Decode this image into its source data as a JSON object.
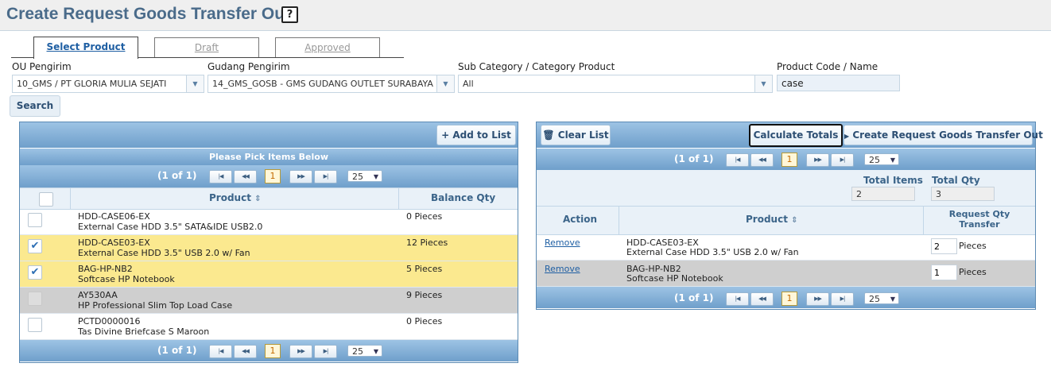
{
  "page": {
    "title": "Create Request Goods Transfer Out",
    "help_icon": "?"
  },
  "tabs": [
    "Select Product",
    "Draft",
    "Approved"
  ],
  "filters": {
    "ou_label": "OU Pengirim",
    "ou_value": "10_GMS / PT GLORIA MULIA SEJATI",
    "gudang_label": "Gudang Pengirim",
    "gudang_value": "14_GMS_GOSB - GMS GUDANG OUTLET SURABAYA",
    "category_label": "Sub Category / Category Product",
    "category_value": "All",
    "code_label": "Product Code / Name",
    "code_value": "case",
    "search_label": "Search"
  },
  "left_panel": {
    "add_label": "Add to List",
    "caption": "Please Pick Items Below",
    "pager": {
      "info": "(1 of 1)",
      "page": "1",
      "per_page": "25"
    },
    "columns": {
      "product": "Product",
      "balance": "Balance Qty"
    },
    "rows": [
      {
        "code": "HDD-CASE06-EX",
        "name": "External Case HDD 3.5\" SATA&IDE USB2.0",
        "balance": "0 Pieces",
        "checked": false,
        "state": "normal"
      },
      {
        "code": "HDD-CASE03-EX",
        "name": "External Case HDD 3.5\" USB 2.0 w/ Fan",
        "balance": "12 Pieces",
        "checked": true,
        "state": "selected"
      },
      {
        "code": "BAG-HP-NB2",
        "name": "Softcase HP Notebook",
        "balance": "5 Pieces",
        "checked": true,
        "state": "selected"
      },
      {
        "code": "AY530AA",
        "name": "HP Professional Slim Top Load Case",
        "balance": "9 Pieces",
        "checked": false,
        "state": "gray"
      },
      {
        "code": "PCTD0000016",
        "name": "Tas Divine Briefcase S Maroon",
        "balance": "0 Pieces",
        "checked": false,
        "state": "normal"
      }
    ]
  },
  "right_panel": {
    "clear_label": "Clear List",
    "calc_label": "Calculate Totals",
    "create_label": "Create Request Goods Transfer Out",
    "pager": {
      "info": "(1 of 1)",
      "page": "1",
      "per_page": "25"
    },
    "totals": {
      "items_label": "Total Items",
      "items_value": "2",
      "qty_label": "Total Qty",
      "qty_value": "3"
    },
    "columns": {
      "action": "Action",
      "product": "Product",
      "request_qty": "Request Qty Transfer"
    },
    "rows": [
      {
        "action": "Remove",
        "code": "HDD-CASE03-EX",
        "name": "External Case HDD 3.5\" USB 2.0 w/ Fan",
        "qty": "2",
        "unit": "Pieces",
        "state": "normal"
      },
      {
        "action": "Remove",
        "code": "BAG-HP-NB2",
        "name": "Softcase HP Notebook",
        "qty": "1",
        "unit": "Pieces",
        "state": "gray"
      }
    ]
  },
  "colors": {
    "title": "#4a6b8a",
    "bar": "#6f9fcb",
    "selected_row": "#fbe98f",
    "gray_row": "#cfcfcf",
    "link": "#1f5fa3"
  }
}
